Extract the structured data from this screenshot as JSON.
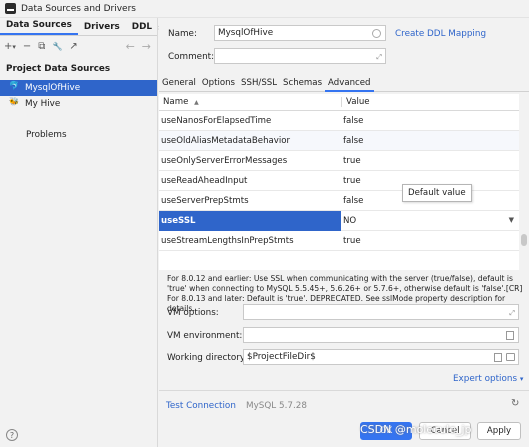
{
  "window": {
    "title": "Data Sources and Drivers"
  },
  "left": {
    "tabs": [
      "Data Sources",
      "Drivers",
      "DDL"
    ],
    "more": "»",
    "toolbar": {
      "add": "+",
      "add_arrow": "▾",
      "remove": "−",
      "copy": "⧉",
      "settings": "🔧",
      "export": "↗",
      "back": "←",
      "forward": "→"
    },
    "section": "Project Data Sources",
    "items": [
      {
        "label": "MysqlOfHive",
        "icon": "mysql-icon",
        "selected": true
      },
      {
        "label": "My Hive",
        "icon": "hive-icon",
        "selected": false
      }
    ],
    "problems": "Problems",
    "help": "?"
  },
  "form": {
    "name_label": "Name:",
    "name_value": "MysqlOfHive",
    "comment_label": "Comment:",
    "create_ddl": "Create DDL Mapping"
  },
  "subtabs": [
    "General",
    "Options",
    "SSH/SSL",
    "Schemas",
    "Advanced"
  ],
  "table": {
    "col_name": "Name",
    "col_value": "Value",
    "sort_icon": "▲",
    "rows": [
      {
        "name": "useNanosForElapsedTime",
        "value": "false"
      },
      {
        "name": "useOldAliasMetadataBehavior",
        "value": "false"
      },
      {
        "name": "useOnlyServerErrorMessages",
        "value": "true"
      },
      {
        "name": "useReadAheadInput",
        "value": "true"
      },
      {
        "name": "useServerPrepStmts",
        "value": "false"
      },
      {
        "name": "useSSL",
        "value": "NO",
        "selected": true
      },
      {
        "name": "useStreamLengthsInPrepStmts",
        "value": "true"
      }
    ]
  },
  "tooltip": "Default value",
  "description": "For 8.0.12 and earlier: Use SSL when communicating with the server (true/false), default is 'true' when connecting to MySQL 5.5.45+, 5.6.26+ or 5.7.6+, otherwise default is 'false'.[CR] For 8.0.13 and later: Default is 'true'. DEPRECATED. See sslMode property description for details.",
  "vm": {
    "options_label": "VM options:",
    "env_label": "VM environment:",
    "workdir_label": "Working directory:",
    "workdir_value": "$ProjectFileDir$",
    "expert": "Expert options"
  },
  "footer": {
    "test_connection": "Test Connection",
    "version": "MySQL 5.7.28",
    "ok": "OK",
    "cancel": "Cancel",
    "apply": "Apply"
  },
  "watermark": "CSDN @molecule_jp"
}
